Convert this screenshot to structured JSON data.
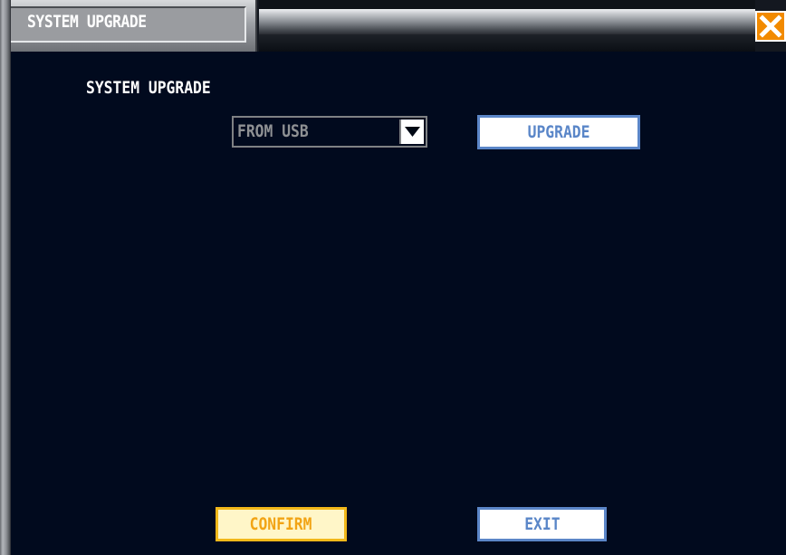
{
  "window": {
    "title": "SYSTEM UPGRADE"
  },
  "icons": {
    "close": "close-icon",
    "dropdown": "chevron-down-icon"
  },
  "main": {
    "section_label": "SYSTEM UPGRADE",
    "source_select": {
      "value": "FROM USB"
    },
    "upgrade_label": "UPGRADE"
  },
  "footer": {
    "confirm_label": "CONFIRM",
    "exit_label": "EXIT"
  },
  "colors": {
    "background": "#010a1e",
    "close_button": "#f28a00",
    "confirm_accent": "#f2a415",
    "button_accent": "#5a86c8"
  }
}
